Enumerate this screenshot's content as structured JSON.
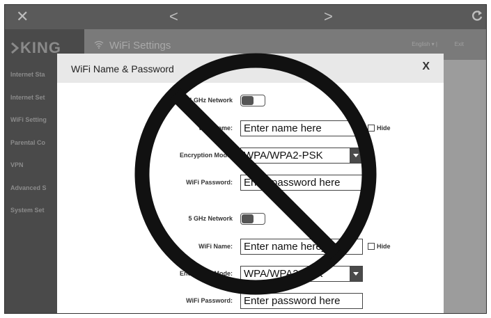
{
  "topbar": {
    "close_glyph": "✕",
    "back_glyph": "<",
    "forward_glyph": ">",
    "refresh_icon": "refresh-icon"
  },
  "sidebar": {
    "logo": "KING",
    "items": [
      {
        "label": "Internet Sta"
      },
      {
        "label": "Internet Set"
      },
      {
        "label": "WiFi Setting"
      },
      {
        "label": "Parental Co"
      },
      {
        "label": "VPN"
      },
      {
        "label": "Advanced S"
      },
      {
        "label": "System Set"
      }
    ]
  },
  "header": {
    "wifi_icon": "wifi-icon",
    "title": "WiFi Settings",
    "language": "English  ▾  |",
    "exit": "Exit"
  },
  "modal": {
    "title": "WiFi Name & Password",
    "close_label": "X",
    "band_24": {
      "network_label": "2.4 GHz Network",
      "name_label": "WiFi Name:",
      "name_placeholder": "Enter name here",
      "hide_label": "Hide",
      "encryption_label": "Encryption Mode:",
      "encryption_value": "WPA/WPA2-PSK",
      "password_label": "WiFi Password:",
      "password_placeholder": "Enter password here"
    },
    "band_5": {
      "network_label": "5 GHz Network",
      "name_label": "WiFi Name:",
      "name_placeholder": "Enter name here_5G",
      "hide_label": "Hide",
      "encryption_label": "Encryption Mode:",
      "encryption_value": "WPA/WPA2-PSK",
      "password_label": "WiFi Password:",
      "password_placeholder": "Enter password here"
    }
  },
  "overlay": {
    "symbol": "prohibition-sign",
    "color": "#111111"
  }
}
